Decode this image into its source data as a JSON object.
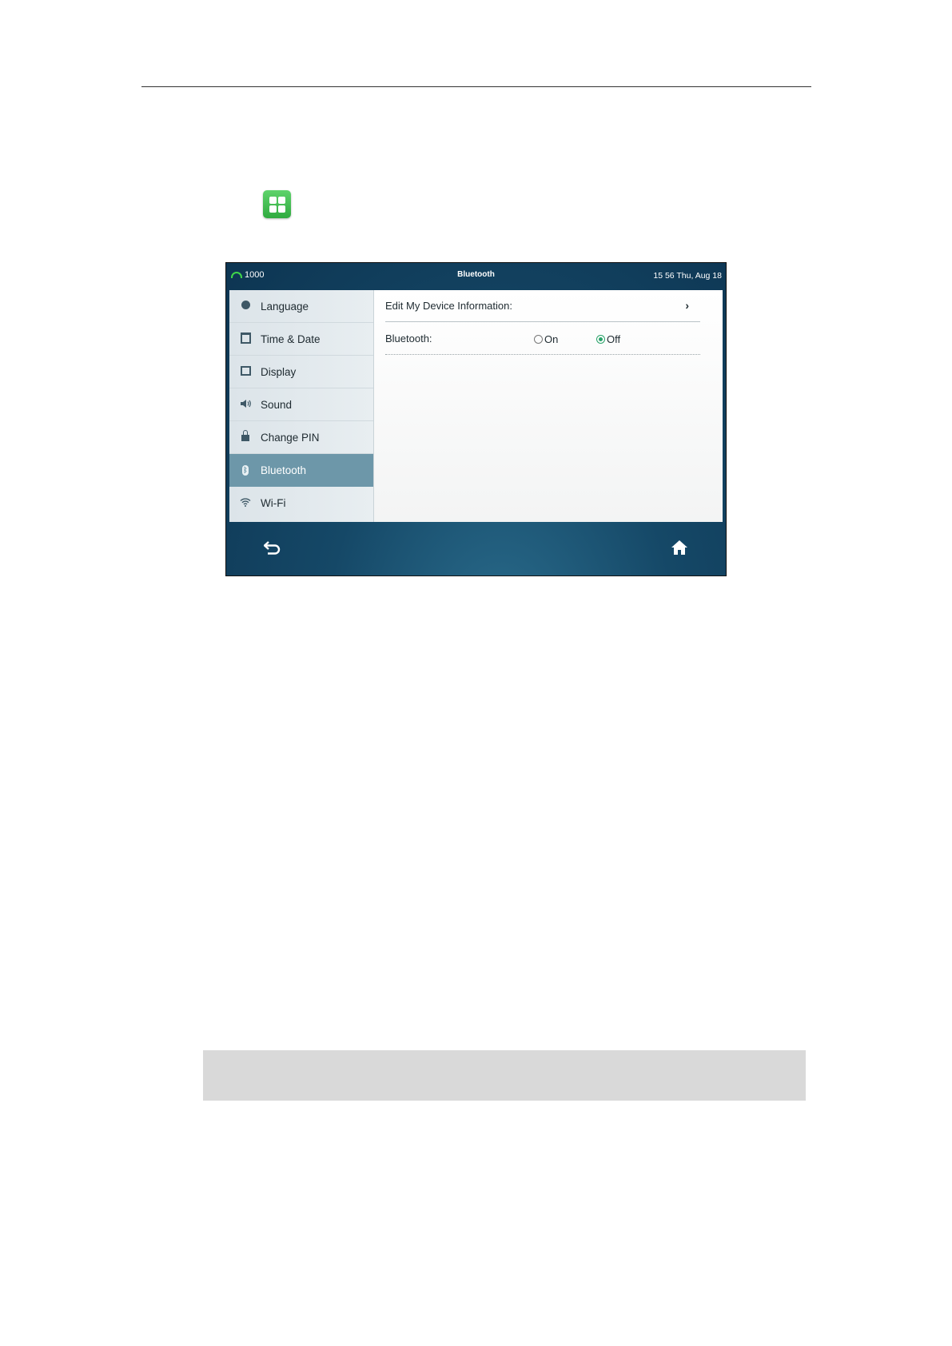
{
  "phone": {
    "status_bar": {
      "account": "1000",
      "title": "Bluetooth",
      "clock": "15 56 Thu, Aug 18"
    },
    "sidebar": {
      "items": [
        {
          "label": "Language",
          "icon": "language-icon"
        },
        {
          "label": "Time & Date",
          "icon": "calendar-icon"
        },
        {
          "label": "Display",
          "icon": "display-icon"
        },
        {
          "label": "Sound",
          "icon": "speaker-icon"
        },
        {
          "label": "Change PIN",
          "icon": "lock-icon"
        },
        {
          "label": "Bluetooth",
          "icon": "bluetooth-icon",
          "active": true
        },
        {
          "label": "Wi-Fi",
          "icon": "wifi-icon"
        }
      ]
    },
    "settings": {
      "edit_device_label": "Edit My Device Information:",
      "bluetooth_label": "Bluetooth:",
      "on_label": "On",
      "off_label": "Off",
      "selected": "Off"
    },
    "accent_color": "#2aa36a"
  }
}
